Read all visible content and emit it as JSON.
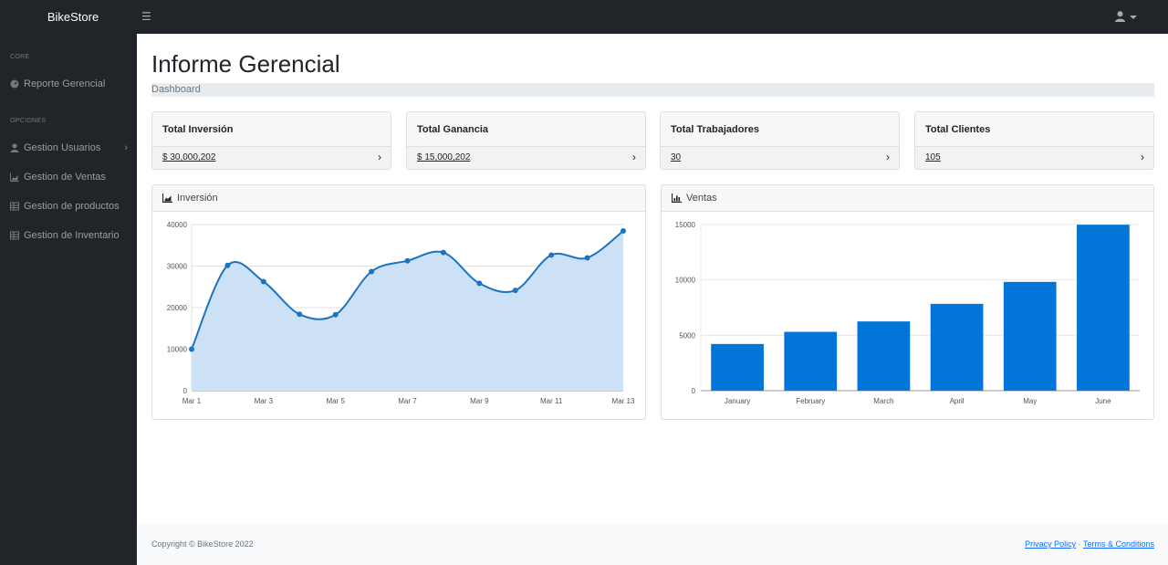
{
  "brand": "BikeStore",
  "toggle_icon": "menu-icon",
  "sidebar": {
    "headings": [
      "CORE",
      "OPCIONES"
    ],
    "items": [
      {
        "label": "Reporte Gerencial",
        "icon": "dashboard-icon"
      },
      {
        "label": "Gestion Usuarios",
        "icon": "user-icon",
        "expandable": true
      },
      {
        "label": "Gestion de Ventas",
        "icon": "chart-area-icon"
      },
      {
        "label": "Gestion de productos",
        "icon": "table-icon"
      },
      {
        "label": "Gestion de Inventario",
        "icon": "table-icon"
      }
    ]
  },
  "page": {
    "title": "Informe Gerencial",
    "breadcrumb": "Dashboard"
  },
  "stats": [
    {
      "label": "Total Inversión",
      "value": "$ 30,000,202"
    },
    {
      "label": "Total Ganancia",
      "value": "$ 15,000,202"
    },
    {
      "label": "Total Trabajadores",
      "value": "30"
    },
    {
      "label": "Total Clientes",
      "value": "105"
    }
  ],
  "charts": {
    "inversion_title": "Inversión",
    "ventas_title": "Ventas"
  },
  "chart_data": [
    {
      "type": "area",
      "title": "Inversión",
      "x": [
        "Mar 1",
        "Mar 2",
        "Mar 3",
        "Mar 4",
        "Mar 5",
        "Mar 6",
        "Mar 7",
        "Mar 8",
        "Mar 9",
        "Mar 10",
        "Mar 11",
        "Mar 12",
        "Mar 13"
      ],
      "x_tick_labels": [
        "Mar 1",
        "Mar 3",
        "Mar 5",
        "Mar 7",
        "Mar 9",
        "Mar 11",
        "Mar 13"
      ],
      "values": [
        10000,
        30162,
        26263,
        18394,
        18287,
        28682,
        31274,
        33259,
        25849,
        24159,
        32651,
        31984,
        38451
      ],
      "ylim": [
        0,
        40000
      ],
      "yticks": [
        0,
        10000,
        20000,
        30000,
        40000
      ],
      "grid": true,
      "color": "#0d6efd",
      "line_color": "#1e73be",
      "fill_color": "#cce1f5"
    },
    {
      "type": "bar",
      "title": "Ventas",
      "categories": [
        "January",
        "February",
        "March",
        "April",
        "May",
        "June"
      ],
      "values": [
        4215,
        5312,
        6251,
        7841,
        9821,
        14984
      ],
      "ylim": [
        0,
        15000
      ],
      "yticks": [
        0,
        5000,
        10000,
        15000
      ],
      "grid": true,
      "color": "#0275d8"
    }
  ],
  "footer": {
    "copyright": "Copyright © BikeStore 2022",
    "privacy": "Privacy Policy",
    "separator": "·",
    "terms": "Terms & Conditions"
  }
}
